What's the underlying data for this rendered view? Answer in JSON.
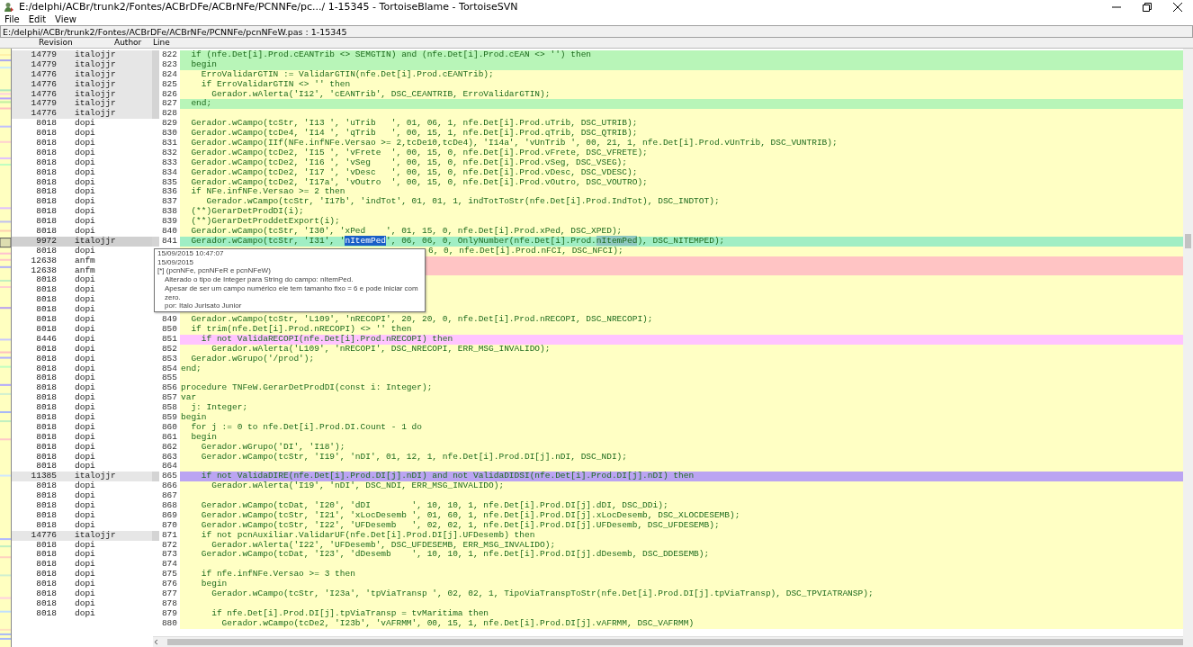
{
  "window": {
    "title": "E:/delphi/ACBr/trunk2/Fontes/ACBrDFe/ACBrNFe/PCNNFe/pc.../ 1-15345 - TortoiseBlame - TortoiseSVN"
  },
  "menu": [
    "File",
    "Edit",
    "View"
  ],
  "path_bar": "E:/delphi/ACBr/trunk2/Fontes/ACBrDFe/ACBrNFe/PCNNFe/pcnNFeW.pas : 1-15345",
  "columns": [
    "Revision",
    "Author",
    "Line"
  ],
  "rows": [
    {
      "kind": "line",
      "number": "822",
      "revision": "14779",
      "author": "italojjr",
      "highlighted": true,
      "selected": false,
      "color": "#b8f5b8",
      "code": "  if (nfe.Det[i].Prod.cEANTrib <> SEMGTIN) and (nfe.Det[i].Prod.cEAN <> '') then"
    },
    {
      "kind": "line",
      "number": "823",
      "revision": "14779",
      "author": "italojjr",
      "highlighted": true,
      "selected": false,
      "color": "#b8f5b8",
      "code": "  begin"
    },
    {
      "kind": "line",
      "number": "824",
      "revision": "14776",
      "author": "italojjr",
      "highlighted": true,
      "selected": false,
      "code": "    ErroValidarGTIN := ValidarGTIN(nfe.Det[i].Prod.cEANTrib);"
    },
    {
      "kind": "line",
      "number": "825",
      "revision": "14776",
      "author": "italojjr",
      "highlighted": true,
      "selected": false,
      "code": "    if ErroValidarGTIN <> '' then"
    },
    {
      "kind": "line",
      "number": "826",
      "revision": "14776",
      "author": "italojjr",
      "highlighted": true,
      "selected": false,
      "code": "      Gerador.wAlerta('I12', 'cEANTrib', DSC_CEANTRIB, ErroValidarGTIN);"
    },
    {
      "kind": "line",
      "number": "827",
      "revision": "14779",
      "author": "italojjr",
      "highlighted": true,
      "selected": false,
      "color": "#b8f5b8",
      "code": "  end;"
    },
    {
      "kind": "line",
      "number": "828",
      "revision": "14776",
      "author": "italojjr",
      "highlighted": true,
      "selected": false
    },
    {
      "kind": "line",
      "number": "829",
      "revision": "8018",
      "author": "dopi",
      "highlighted": false,
      "selected": false,
      "code": "  Gerador.wCampo(tcStr, 'I13 ', 'uTrib   ', 01, 06, 1, nfe.Det[i].Prod.uTrib, DSC_UTRIB);"
    },
    {
      "kind": "line",
      "number": "830",
      "revision": "8018",
      "author": "dopi",
      "highlighted": false,
      "selected": false,
      "code": "  Gerador.wCampo(tcDe4, 'I14 ', 'qTrib   ', 00, 15, 1, nfe.Det[i].Prod.qTrib, DSC_QTRIB);"
    },
    {
      "kind": "line",
      "number": "831",
      "revision": "8018",
      "author": "dopi",
      "highlighted": false,
      "selected": false,
      "code": "  Gerador.wCampo(IIf(NFe.infNFe.Versao >= 2,tcDe10,tcDe4), 'I14a', 'vUnTrib ', 00, 21, 1, nfe.Det[i].Prod.vUnTrib, DSC_VUNTRIB);"
    },
    {
      "kind": "line",
      "number": "832",
      "revision": "8018",
      "author": "dopi",
      "highlighted": false,
      "selected": false,
      "code": "  Gerador.wCampo(tcDe2, 'I15 ', 'vFrete  ', 00, 15, 0, nfe.Det[i].Prod.vFrete, DSC_VFRETE);"
    },
    {
      "kind": "line",
      "number": "833",
      "revision": "8018",
      "author": "dopi",
      "highlighted": false,
      "selected": false,
      "code": "  Gerador.wCampo(tcDe2, 'I16 ', 'vSeg    ', 00, 15, 0, nfe.Det[i].Prod.vSeg, DSC_VSEG);"
    },
    {
      "kind": "line",
      "number": "834",
      "revision": "8018",
      "author": "dopi",
      "highlighted": false,
      "selected": false,
      "code": "  Gerador.wCampo(tcDe2, 'I17 ', 'vDesc   ', 00, 15, 0, nfe.Det[i].Prod.vDesc, DSC_VDESC);"
    },
    {
      "kind": "line",
      "number": "835",
      "revision": "8018",
      "author": "dopi",
      "highlighted": false,
      "selected": false,
      "code": "  Gerador.wCampo(tcDe2, 'I17a', 'vOutro  ', 00, 15, 0, nfe.Det[i].Prod.vOutro, DSC_VOUTRO);"
    },
    {
      "kind": "line",
      "number": "836",
      "revision": "8018",
      "author": "dopi",
      "highlighted": false,
      "selected": false,
      "code": "  if NFe.infNFe.Versao >= 2 then"
    },
    {
      "kind": "line",
      "number": "837",
      "revision": "8018",
      "author": "dopi",
      "highlighted": false,
      "selected": false,
      "code": "     Gerador.wCampo(tcStr, 'I17b', 'indTot', 01, 01, 1, indTotToStr(nfe.Det[i].Prod.IndTot), DSC_INDTOT);"
    },
    {
      "kind": "line",
      "number": "838",
      "revision": "8018",
      "author": "dopi",
      "highlighted": false,
      "selected": false,
      "code": "  (**)GerarDetProdDI(i);"
    },
    {
      "kind": "line",
      "number": "839",
      "revision": "8018",
      "author": "dopi",
      "highlighted": false,
      "selected": false,
      "code": "  (**)GerarDetProddetExport(i);"
    },
    {
      "kind": "line",
      "number": "840",
      "revision": "8018",
      "author": "dopi",
      "highlighted": false,
      "selected": false,
      "code": "  Gerador.wCampo(tcStr, 'I30', 'xPed    ', 01, 15, 0, nfe.Det[i].Prod.xPed, DSC_XPED);"
    },
    {
      "kind": "line",
      "number": "841",
      "revision": "9972",
      "author": "italojjr",
      "highlighted": true,
      "selected": true,
      "color": "#a0eec4",
      "segments": [
        {
          "kind": "plain",
          "text": "  Gerador.wCampo(tcStr, 'I31', '"
        },
        {
          "kind": "selection",
          "text": "nItemPed"
        },
        {
          "kind": "plain",
          "text": "', 06, 06, 0, OnlyNumber(nfe.Det[i].Prod."
        },
        {
          "kind": "match",
          "text": "nItemPed"
        },
        {
          "kind": "plain",
          "text": "), DSC_NITEMPED);"
        }
      ]
    },
    {
      "kind": "covered",
      "revision": "8018",
      "author": "dopi",
      "highlighted": false,
      "selected": false,
      "code": "6, 0, nfe.Det[i].Prod.nFCI, DSC_NFCI);"
    },
    {
      "kind": "covered",
      "revision": "12638",
      "author": "anfm",
      "highlighted": false,
      "selected": false,
      "color": "#ffc4c4"
    },
    {
      "kind": "covered",
      "revision": "12638",
      "author": "anfm",
      "highlighted": false,
      "selected": false,
      "color": "#ffc4c4"
    },
    {
      "kind": "covered",
      "revision": "8018",
      "author": "dopi",
      "highlighted": false,
      "selected": false
    },
    {
      "kind": "covered",
      "revision": "8018",
      "author": "dopi",
      "highlighted": false,
      "selected": false
    },
    {
      "kind": "covered",
      "revision": "8018",
      "author": "dopi",
      "highlighted": false,
      "selected": false
    },
    {
      "kind": "covered",
      "revision": "8018",
      "author": "dopi",
      "highlighted": false,
      "selected": false
    },
    {
      "kind": "line",
      "number": "849",
      "revision": "8018",
      "author": "dopi",
      "highlighted": false,
      "selected": false,
      "code": "  Gerador.wCampo(tcStr, 'L109', 'nRECOPI', 20, 20, 0, nfe.Det[i].Prod.nRECOPI, DSC_NRECOPI);"
    },
    {
      "kind": "line",
      "number": "850",
      "revision": "8018",
      "author": "dopi",
      "highlighted": false,
      "selected": false,
      "code": "  if trim(nfe.Det[i].Prod.nRECOPI) <> '' then"
    },
    {
      "kind": "line",
      "number": "851",
      "revision": "8446",
      "author": "dopi",
      "highlighted": false,
      "selected": false,
      "color": "#ffc4ff",
      "code": "    if not ValidaRECOPI(nfe.Det[i].Prod.nRECOPI) then"
    },
    {
      "kind": "line",
      "number": "852",
      "revision": "8018",
      "author": "dopi",
      "highlighted": false,
      "selected": false,
      "code": "      Gerador.wAlerta('L109', 'nRECOPI', DSC_NRECOPI, ERR_MSG_INVALIDO);"
    },
    {
      "kind": "line",
      "number": "853",
      "revision": "8018",
      "author": "dopi",
      "highlighted": false,
      "selected": false,
      "code": "  Gerador.wGrupo('/prod');"
    },
    {
      "kind": "line",
      "number": "854",
      "revision": "8018",
      "author": "dopi",
      "highlighted": false,
      "selected": false,
      "code": "end;"
    },
    {
      "kind": "line",
      "number": "855",
      "revision": "8018",
      "author": "dopi",
      "highlighted": false,
      "selected": false
    },
    {
      "kind": "line",
      "number": "856",
      "revision": "8018",
      "author": "dopi",
      "highlighted": false,
      "selected": false,
      "code": "procedure TNFeW.GerarDetProdDI(const i: Integer);"
    },
    {
      "kind": "line",
      "number": "857",
      "revision": "8018",
      "author": "dopi",
      "highlighted": false,
      "selected": false,
      "code": "var"
    },
    {
      "kind": "line",
      "number": "858",
      "revision": "8018",
      "author": "dopi",
      "highlighted": false,
      "selected": false,
      "code": "  j: Integer;"
    },
    {
      "kind": "line",
      "number": "859",
      "revision": "8018",
      "author": "dopi",
      "highlighted": false,
      "selected": false,
      "code": "begin"
    },
    {
      "kind": "line",
      "number": "860",
      "revision": "8018",
      "author": "dopi",
      "highlighted": false,
      "selected": false,
      "code": "  for j := 0 to nfe.Det[i].Prod.DI.Count - 1 do"
    },
    {
      "kind": "line",
      "number": "861",
      "revision": "8018",
      "author": "dopi",
      "highlighted": false,
      "selected": false,
      "code": "  begin"
    },
    {
      "kind": "line",
      "number": "862",
      "revision": "8018",
      "author": "dopi",
      "highlighted": false,
      "selected": false,
      "code": "    Gerador.wGrupo('DI', 'I18');"
    },
    {
      "kind": "line",
      "number": "863",
      "revision": "8018",
      "author": "dopi",
      "highlighted": false,
      "selected": false,
      "code": "    Gerador.wCampo(tcStr, 'I19', 'nDI', 01, 12, 1, nfe.Det[i].Prod.DI[j].nDI, DSC_NDI);"
    },
    {
      "kind": "line",
      "number": "864",
      "revision": "8018",
      "author": "dopi",
      "highlighted": false,
      "selected": false
    },
    {
      "kind": "line",
      "number": "865",
      "revision": "11385",
      "author": "italojjr",
      "highlighted": true,
      "selected": false,
      "color": "#bba4f2",
      "code": "    if not ValidaDIRE(nfe.Det[i].Prod.DI[j].nDI) and not ValidaDIDSI(nfe.Det[i].Prod.DI[j].nDI) then"
    },
    {
      "kind": "line",
      "number": "866",
      "revision": "8018",
      "author": "dopi",
      "highlighted": false,
      "selected": false,
      "code": "      Gerador.wAlerta('I19', 'nDI', DSC_NDI, ERR_MSG_INVALIDO);"
    },
    {
      "kind": "line",
      "number": "867",
      "revision": "8018",
      "author": "dopi",
      "highlighted": false,
      "selected": false
    },
    {
      "kind": "line",
      "number": "868",
      "revision": "8018",
      "author": "dopi",
      "highlighted": false,
      "selected": false,
      "code": "    Gerador.wCampo(tcDat, 'I20', 'dDI        ', 10, 10, 1, nfe.Det[i].Prod.DI[j].dDI, DSC_DDi);"
    },
    {
      "kind": "line",
      "number": "869",
      "revision": "8018",
      "author": "dopi",
      "highlighted": false,
      "selected": false,
      "code": "    Gerador.wCampo(tcStr, 'I21', 'xLocDesemb ', 01, 60, 1, nfe.Det[i].Prod.DI[j].xLocDesemb, DSC_XLOCDESEMB);"
    },
    {
      "kind": "line",
      "number": "870",
      "revision": "8018",
      "author": "dopi",
      "highlighted": false,
      "selected": false,
      "code": "    Gerador.wCampo(tcStr, 'I22', 'UFDesemb   ', 02, 02, 1, nfe.Det[i].Prod.DI[j].UFDesemb, DSC_UFDESEMB);"
    },
    {
      "kind": "line",
      "number": "871",
      "revision": "14776",
      "author": "italojjr",
      "highlighted": true,
      "selected": false,
      "code": "    if not pcnAuxiliar.ValidarUF(nfe.Det[i].Prod.DI[j].UFDesemb) then"
    },
    {
      "kind": "line",
      "number": "872",
      "revision": "8018",
      "author": "dopi",
      "highlighted": false,
      "selected": false,
      "code": "      Gerador.wAlerta('I22', 'UFDesemb', DSC_UFDESEMB, ERR_MSG_INVALIDO);"
    },
    {
      "kind": "line",
      "number": "873",
      "revision": "8018",
      "author": "dopi",
      "highlighted": false,
      "selected": false,
      "code": "    Gerador.wCampo(tcDat, 'I23', 'dDesemb    ', 10, 10, 1, nfe.Det[i].Prod.DI[j].dDesemb, DSC_DDESEMB);"
    },
    {
      "kind": "line",
      "number": "874",
      "revision": "8018",
      "author": "dopi",
      "highlighted": false,
      "selected": false
    },
    {
      "kind": "line",
      "number": "875",
      "revision": "8018",
      "author": "dopi",
      "highlighted": false,
      "selected": false,
      "code": "    if nfe.infNFe.Versao >= 3 then"
    },
    {
      "kind": "line",
      "number": "876",
      "revision": "8018",
      "author": "dopi",
      "highlighted": false,
      "selected": false,
      "code": "    begin"
    },
    {
      "kind": "line",
      "number": "877",
      "revision": "8018",
      "author": "dopi",
      "highlighted": false,
      "selected": false,
      "code": "      Gerador.wCampo(tcStr, 'I23a', 'tpViaTransp ', 02, 02, 1, TipoViaTranspToStr(nfe.Det[i].Prod.DI[j].tpViaTransp), DSC_TPVIATRANSP);"
    },
    {
      "kind": "line",
      "number": "878",
      "revision": "8018",
      "author": "dopi",
      "highlighted": false,
      "selected": false
    },
    {
      "kind": "line",
      "number": "879",
      "revision": "8018",
      "author": "dopi",
      "highlighted": false,
      "selected": false,
      "code": "      if nfe.Det[i].Prod.DI[j].tpViaTransp = tvMaritima then"
    },
    {
      "kind": "line",
      "number": "880",
      "code": "        Gerador.wCampo(tcDe2, 'I23b', 'vAFRMM', 00, 15, 1, nfe.Det[i].Prod.DI[j].vAFRMM, DSC_VAFRMM)"
    }
  ],
  "tooltip": {
    "lines": [
      {
        "kind": "plain",
        "text": "15/09/2015 10:47:07"
      },
      {
        "kind": "plain",
        "text": "15/09/2015"
      },
      {
        "kind": "plain",
        "text": "[*] (pcnNFe, pcnNFeR e pcnNFeW)"
      },
      {
        "kind": "indented",
        "text": "Alterado o tipo de Integer para String do campo: nItemPed."
      },
      {
        "kind": "indented",
        "text": "Apesar de ser um campo numérico ele tem tamanho fixo = 6 e pode iniciar com zero."
      },
      {
        "kind": "indented",
        "text": "por: Italo Jurisato Junior"
      }
    ]
  }
}
